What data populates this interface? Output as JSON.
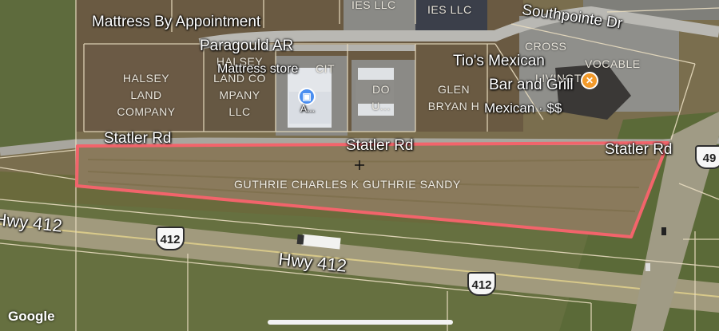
{
  "map": {
    "roads": {
      "statler_left": "Statler Rd",
      "statler_mid": "Statler Rd",
      "statler_right": "Statler Rd",
      "southpointe": "Southpointe Dr",
      "hwy_left": "Hwy 412",
      "hwy_mid": "Hwy 412",
      "hwy_shield_1": "412",
      "hwy_shield_2": "412",
      "route_49": "49"
    },
    "businesses": {
      "mattress_title_1": "Mattress By Appointment",
      "mattress_title_2": "Paragould AR",
      "mattress_store": "Mattress store",
      "mattress_pin_caption": "A...",
      "tios_line1": "Tio's Mexican",
      "tios_line2": "Bar and Grill",
      "tios_category": "Mexican · $$",
      "restaurant_icon": "fork-knife-icon",
      "store_icon": "shopping-bag-icon"
    },
    "parcels": {
      "halsey_1": "HALSEY\nLAND\nCOMPANY",
      "halsey_2": "HALSEY\nLAND CO\nMPANY\nLLC",
      "cit": "CIT",
      "dou": "DO\nU...",
      "glen": "GLEN\nBRYAN H",
      "cross": "CROSS",
      "vocable": "VOCABLE",
      "livingston": "LIVINGTO",
      "ies_1": "IES LLC",
      "ies_2": "IES LLC",
      "owner": "GUTHRIE CHARLES K GUTHRIE SANDY"
    },
    "attribution": "Google",
    "colors": {
      "highlight": "#f2646b",
      "parcel_lines": "#e8dcc0",
      "pin_blue": "#4a8ef0",
      "pin_orange": "#f29a2b"
    }
  }
}
